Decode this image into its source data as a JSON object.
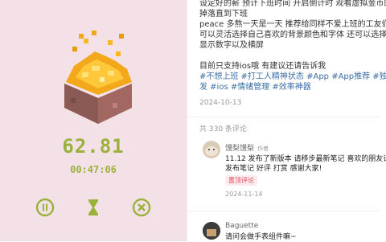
{
  "colors": {
    "accent": "#9bb23a",
    "tag": "#3b6fa8",
    "left_bg": "#f3e1e7",
    "pinned": "#e24a5a"
  },
  "app": {
    "amount": "62.81",
    "timer": "00:47:06",
    "controls": [
      "pause-icon",
      "hourglass-icon",
      "close-icon"
    ]
  },
  "post": {
    "lines": [
      "设定好的薪 预计下班时间 开启倒计时 观看虚拟金币的",
      "掉落直到下班",
      "peace 多熬一天是一天 推荐给同样不爱上班的工友们",
      "可以灵活选择自己喜欢的背景颜色和字体 还可以选择只",
      "显示数字以及横屏",
      "",
      "目前只支持ios哦 有建议还请告诉我"
    ],
    "tags_line1": "#不想上班 #打工人精神状态 #App #App推荐 #独立开",
    "tags_line2": "发 #ios #情绪管理 #效率神器",
    "date": "2024-10-13"
  },
  "comments": {
    "count_label": "共 330 条评论",
    "items": [
      {
        "name": "馒梨馒梨",
        "author_badge": "作者",
        "lines": [
          "11.12 发布了新版本 请移步最新笔记 喜欢的朋友请推荐",
          "发布笔记 好评 打赏 感谢大家!"
        ],
        "pinned": "置顶评论",
        "date": "2024-11-14"
      },
      {
        "name": "Baguette",
        "lines": [
          "请问会做手表组件嘛~"
        ]
      }
    ]
  }
}
